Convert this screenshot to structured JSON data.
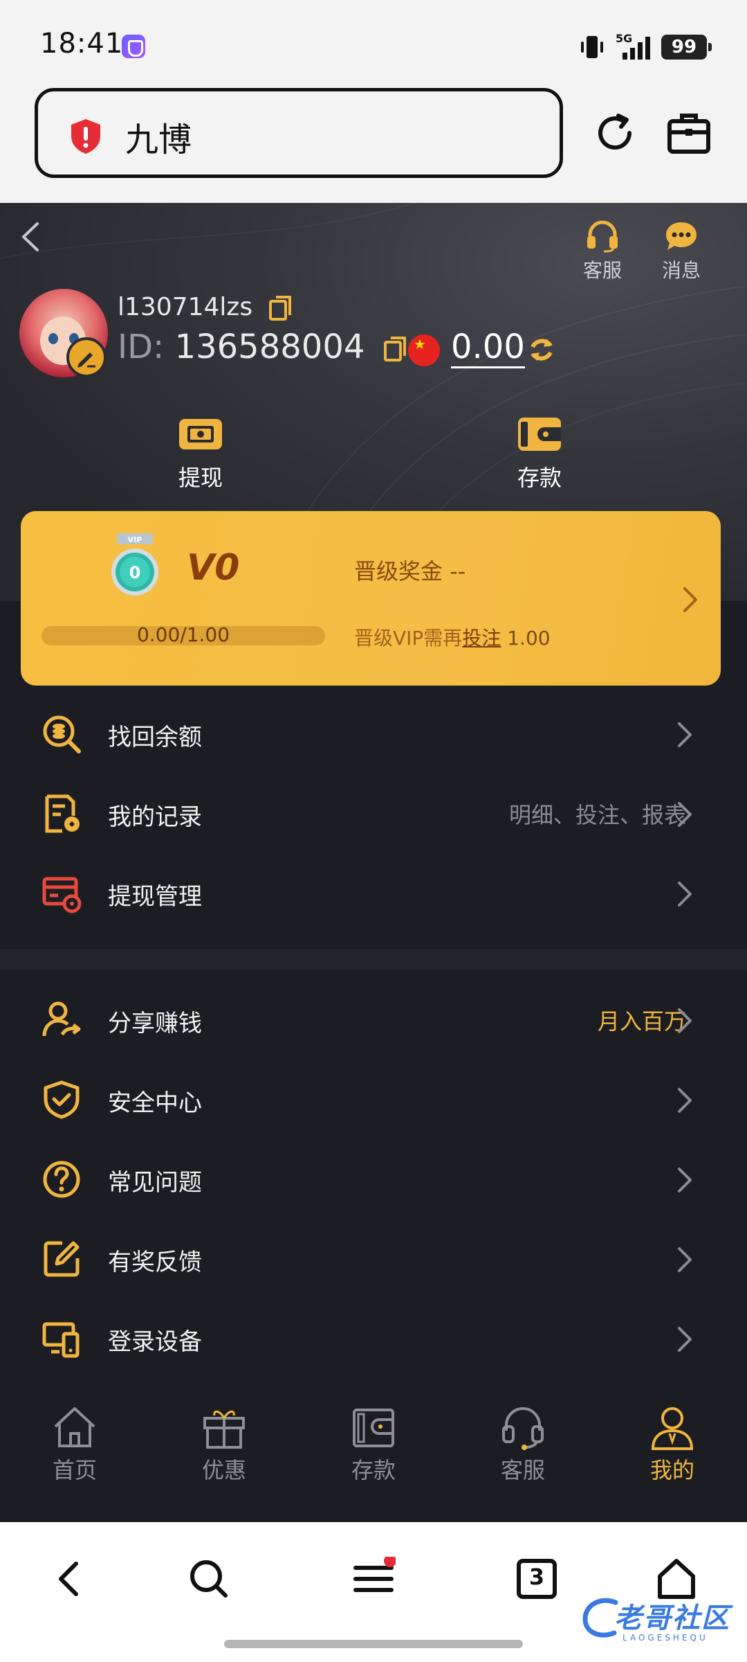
{
  "status_bar": {
    "time": "18:41",
    "network": "5G",
    "battery": "99"
  },
  "browser": {
    "address_text": "九博"
  },
  "header": {
    "actions": [
      {
        "label": "客服",
        "icon": "headset-icon"
      },
      {
        "label": "消息",
        "icon": "chat-bubble-icon"
      }
    ]
  },
  "profile": {
    "username": "l130714lzs",
    "id_label": "ID:",
    "id_value": "136588004",
    "balance": "0.00",
    "currency_flag": "china-flag-icon"
  },
  "quick_actions": [
    {
      "label": "提现",
      "icon": "withdraw-icon"
    },
    {
      "label": "存款",
      "icon": "deposit-wallet-icon"
    }
  ],
  "vip": {
    "medal_number": "0",
    "medal_tag": "VIP",
    "level": "V0",
    "bonus_label": "晋级奖金 --",
    "progress_text": "0.00/1.00",
    "progress_fraction": 0,
    "hint_prefix": "晋级VIP需再",
    "hint_link": "投注",
    "hint_amount": " 1.00"
  },
  "menu_group_1": [
    {
      "label": "找回余额",
      "extra": "",
      "icon": "recover-balance-icon"
    },
    {
      "label": "我的记录",
      "extra": "明细、投注、报表",
      "icon": "records-icon"
    },
    {
      "label": "提现管理",
      "extra": "",
      "icon": "withdraw-management-icon"
    }
  ],
  "menu_group_2": [
    {
      "label": "分享赚钱",
      "extra": "月入百万",
      "icon": "share-earn-icon"
    },
    {
      "label": "安全中心",
      "extra": "",
      "icon": "shield-check-icon"
    },
    {
      "label": "常见问题",
      "extra": "",
      "icon": "question-icon"
    },
    {
      "label": "有奖反馈",
      "extra": "",
      "icon": "feedback-edit-icon"
    },
    {
      "label": "登录设备",
      "extra": "",
      "icon": "devices-icon"
    }
  ],
  "tabbar": [
    {
      "label": "首页",
      "icon": "home-icon",
      "active": false
    },
    {
      "label": "优惠",
      "icon": "gift-icon",
      "active": false
    },
    {
      "label": "存款",
      "icon": "wallet-icon",
      "active": false
    },
    {
      "label": "客服",
      "icon": "headset-icon",
      "active": false
    },
    {
      "label": "我的",
      "icon": "user-icon",
      "active": true
    }
  ],
  "navbar": {
    "tab_count": "3"
  },
  "watermark": {
    "text": "老哥社区",
    "sub": "LAOGESHEQU"
  },
  "colors": {
    "accent": "#f0b540",
    "background": "#1c1d22",
    "vip_card": "#f6bf42",
    "withdraw_icon": "#e8493e"
  }
}
